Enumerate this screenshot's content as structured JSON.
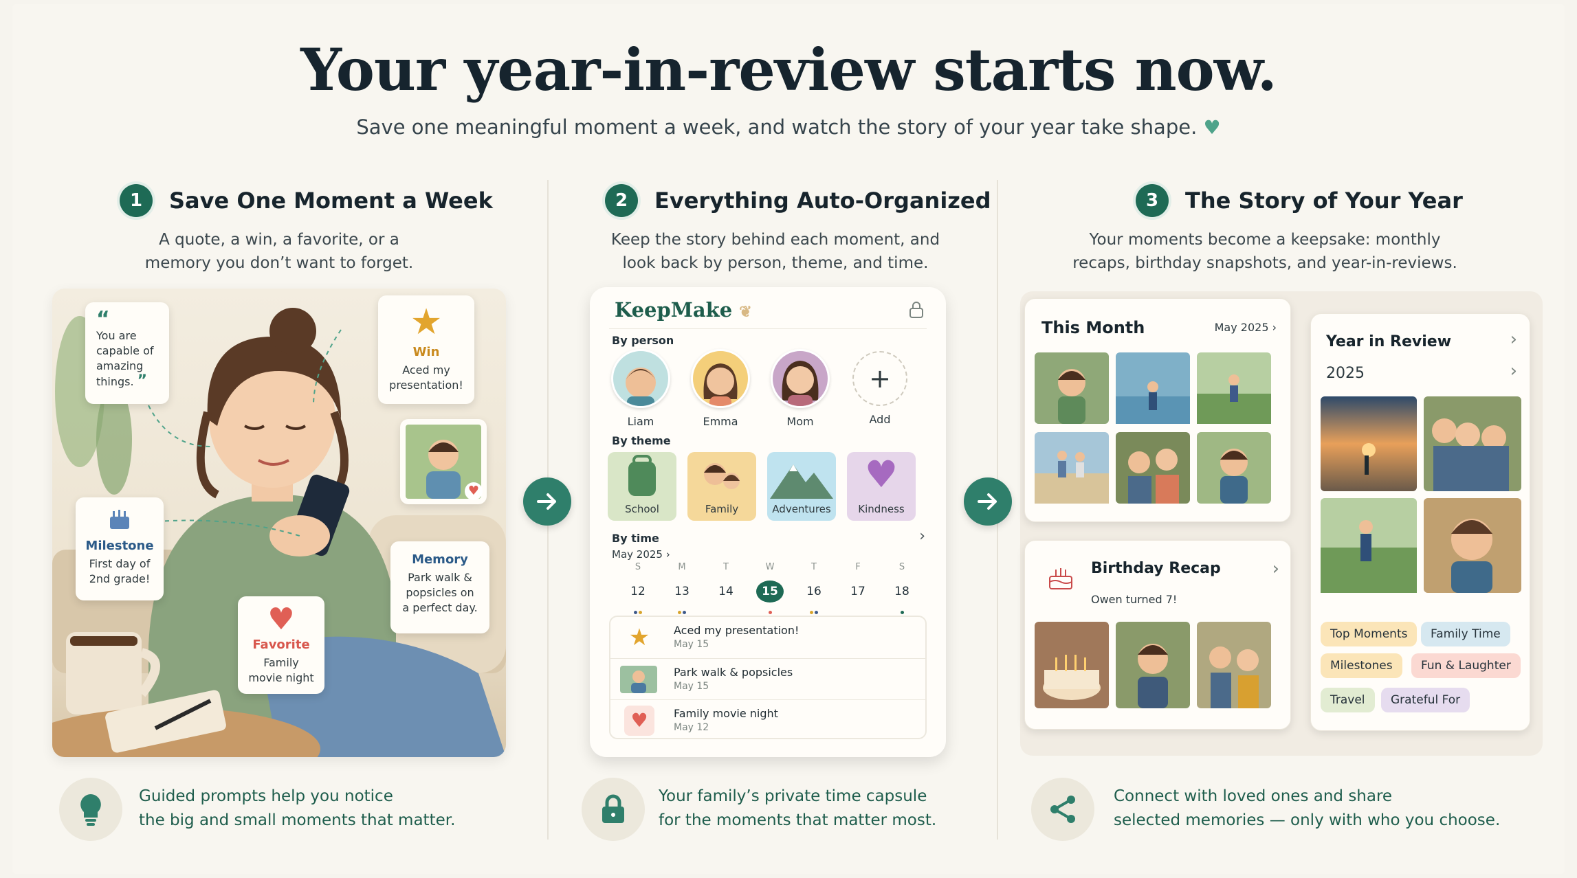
{
  "headline": "Your year-in-review starts now.",
  "subline": "Save one meaningful moment a week, and watch the story of your year take shape.",
  "steps": [
    {
      "num": "1",
      "title": "Save One Moment a Week",
      "desc1": "A quote, a win, a favorite, or a",
      "desc2": "memory you don’t want to forget."
    },
    {
      "num": "2",
      "title": "Everything Auto-Organized",
      "desc1": "Keep the story behind each moment, and",
      "desc2": "look back by person, theme, and time."
    },
    {
      "num": "3",
      "title": "The Story of Your Year",
      "desc1": "Your moments become a keepsake: monthly",
      "desc2": "recaps, birthday snapshots, and year-in-reviews."
    }
  ],
  "panel1": {
    "quote_l1": "You are",
    "quote_l2": "capable of",
    "quote_l3": "amazing",
    "quote_l4": "things.",
    "win_cap": "Win",
    "win_l1": "Aced my",
    "win_l2": "presentation!",
    "milestone_cap": "Milestone",
    "milestone_l1": "First day of",
    "milestone_l2": "2nd grade!",
    "memory_cap": "Memory",
    "memory_l1": "Park walk &",
    "memory_l2": "popsicles on",
    "memory_l3": "a perfect day.",
    "favorite_cap": "Favorite",
    "favorite_l1": "Family",
    "favorite_l2": "movie night"
  },
  "app": {
    "logo": "KeepMake",
    "by_person": "By person",
    "people": [
      "Liam",
      "Emma",
      "Mom",
      "Add"
    ],
    "by_theme": "By theme",
    "themes": [
      "School",
      "Family",
      "Adventures",
      "Kindness"
    ],
    "by_time": "By time",
    "month": "May 2025",
    "dows": [
      "S",
      "M",
      "T",
      "W",
      "T",
      "F",
      "S"
    ],
    "days": [
      "12",
      "13",
      "14",
      "15",
      "16",
      "17",
      "18"
    ],
    "entries": [
      {
        "title": "Aced my presentation!",
        "date": "May 15"
      },
      {
        "title": "Park walk & popsicles",
        "date": "May 15"
      },
      {
        "title": "Family movie night",
        "date": "May 12"
      }
    ]
  },
  "panel3": {
    "this_month": "This Month",
    "this_month_date": "May 2025",
    "birthday_title": "Birthday Recap",
    "birthday_sub": "Owen turned 7!",
    "year_title": "Year in Review",
    "year": "2025",
    "tags": [
      "Top Moments",
      "Family Time",
      "Milestones",
      "Fun & Laughter",
      "Travel",
      "Grateful For"
    ]
  },
  "footers": [
    {
      "l1": "Guided prompts help you notice",
      "l2": "the big and small moments that matter."
    },
    {
      "l1": "Your family’s private time capsule",
      "l2": "for the moments that matter most."
    },
    {
      "l1": "Connect with loved ones and share",
      "l2": "selected memories — only with who you choose."
    }
  ],
  "colors": {
    "accent": "#1e6a55",
    "arrow": "#2f7f6b",
    "footer_text": "#1e5d4c"
  },
  "icons": [
    "heart-icon",
    "arrow-right-icon",
    "lock-icon",
    "lightbulb-icon",
    "share-icon",
    "star-icon",
    "cake-icon",
    "plus-icon",
    "chevron-right-icon",
    "quote-icon"
  ]
}
